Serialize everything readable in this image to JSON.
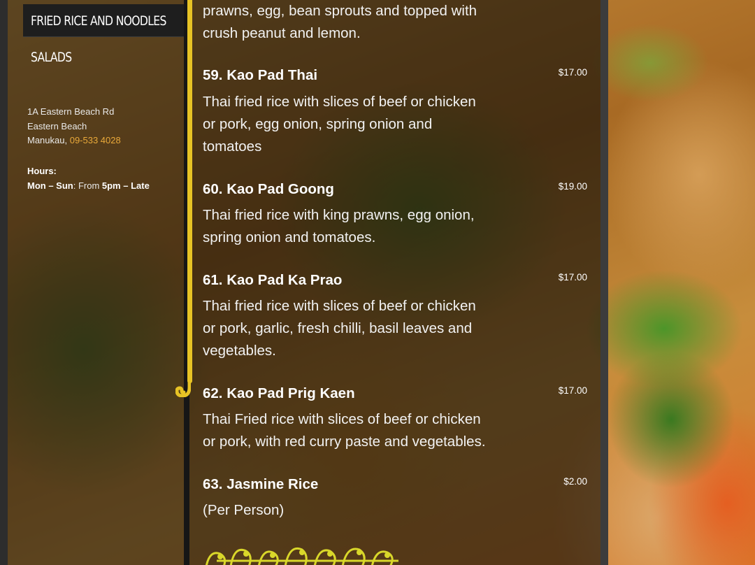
{
  "sidebar": {
    "nav": [
      {
        "label": "FRIED RICE AND NOODLES",
        "active": true
      },
      {
        "label": "SALADS",
        "active": false
      }
    ],
    "address": {
      "line1": "1A Eastern Beach Rd",
      "line2": "Eastern Beach",
      "city": "Manukau,",
      "phone": "09-533 4028"
    },
    "hours": {
      "heading": "Hours:",
      "days": "Mon – Sun",
      "from_label": ": From ",
      "time": "5pm – Late"
    }
  },
  "menu": {
    "partial_desc_lines": [
      "prawns, egg, bean sprouts and topped with",
      "crush peanut and lemon."
    ],
    "items": [
      {
        "title": "59. Kao Pad Thai",
        "price": "$17.00",
        "desc": [
          "Thai fried rice with slices of beef or chicken",
          "or pork, egg onion, spring onion and",
          "tomatoes"
        ]
      },
      {
        "title": "60. Kao Pad Goong",
        "price": "$19.00",
        "desc": [
          "Thai fried rice with king prawns, egg onion,",
          "spring onion and tomatoes."
        ]
      },
      {
        "title": "61. Kao Pad Ka Prao",
        "price": "$17.00",
        "desc": [
          "Thai fried rice with slices of beef or chicken",
          "or pork, garlic, fresh chilli, basil leaves and",
          "vegetables."
        ]
      },
      {
        "title": "62. Kao Pad Prig Kaen",
        "price": "$17.00",
        "desc": [
          "Thai Fried rice with slices of beef or chicken",
          "or pork, with red curry paste and vegetables."
        ]
      },
      {
        "title": "63. Jasmine Rice",
        "price": "$2.00",
        "desc": [
          "(Per Person)"
        ]
      }
    ]
  },
  "colors": {
    "accent_gold": "#e7c325",
    "phone_orange": "#e9a93a",
    "panel_dark": "#161616"
  },
  "icons": {
    "divider_hook": "gold-hook-icon",
    "ornament": "floral-ornament-icon"
  }
}
